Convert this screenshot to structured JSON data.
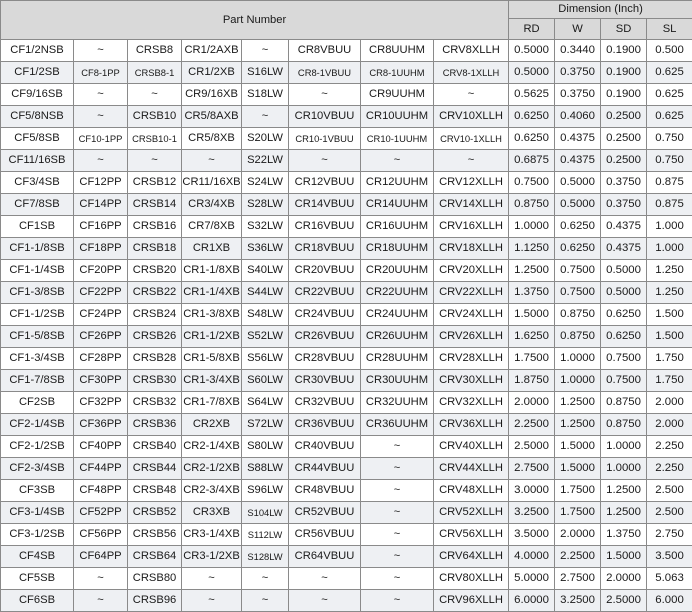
{
  "header": {
    "part_number": "Part Number",
    "dimension": "Dimension (Inch)",
    "sub_columns": [
      "RD",
      "W",
      "SD",
      "SL"
    ]
  },
  "rows": [
    [
      "CF1/2NSB",
      "~",
      "CRSB8",
      "CR1/2AXB",
      "~",
      "CR8VBUU",
      "CR8UUHM",
      "CRV8XLLH",
      "0.5000",
      "0.3440",
      "0.1900",
      "0.500"
    ],
    [
      "CF1/2SB",
      "CF8-1PP",
      "CRSB8-1",
      "CR1/2XB",
      "S16LW",
      "CR8-1VBUU",
      "CR8-1UUHM",
      "CRV8-1XLLH",
      "0.5000",
      "0.3750",
      "0.1900",
      "0.625"
    ],
    [
      "CF9/16SB",
      "~",
      "~",
      "CR9/16XB",
      "S18LW",
      "~",
      "CR9UUHM",
      "~",
      "0.5625",
      "0.3750",
      "0.1900",
      "0.625"
    ],
    [
      "CF5/8NSB",
      "~",
      "CRSB10",
      "CR5/8AXB",
      "~",
      "CR10VBUU",
      "CR10UUHM",
      "CRV10XLLH",
      "0.6250",
      "0.4060",
      "0.2500",
      "0.625"
    ],
    [
      "CF5/8SB",
      "CF10-1PP",
      "CRSB10-1",
      "CR5/8XB",
      "S20LW",
      "CR10-1VBUU",
      "CR10-1UUHM",
      "CRV10-1XLLH",
      "0.6250",
      "0.4375",
      "0.2500",
      "0.750"
    ],
    [
      "CF11/16SB",
      "~",
      "~",
      "~",
      "S22LW",
      "~",
      "~",
      "~",
      "0.6875",
      "0.4375",
      "0.2500",
      "0.750"
    ],
    [
      "CF3/4SB",
      "CF12PP",
      "CRSB12",
      "CR11/16XB",
      "S24LW",
      "CR12VBUU",
      "CR12UUHM",
      "CRV12XLLH",
      "0.7500",
      "0.5000",
      "0.3750",
      "0.875"
    ],
    [
      "CF7/8SB",
      "CF14PP",
      "CRSB14",
      "CR3/4XB",
      "S28LW",
      "CR14VBUU",
      "CR14UUHM",
      "CRV14XLLH",
      "0.8750",
      "0.5000",
      "0.3750",
      "0.875"
    ],
    [
      "CF1SB",
      "CF16PP",
      "CRSB16",
      "CR7/8XB",
      "S32LW",
      "CR16VBUU",
      "CR16UUHM",
      "CRV16XLLH",
      "1.0000",
      "0.6250",
      "0.4375",
      "1.000"
    ],
    [
      "CF1-1/8SB",
      "CF18PP",
      "CRSB18",
      "CR1XB",
      "S36LW",
      "CR18VBUU",
      "CR18UUHM",
      "CRV18XLLH",
      "1.1250",
      "0.6250",
      "0.4375",
      "1.000"
    ],
    [
      "CF1-1/4SB",
      "CF20PP",
      "CRSB20",
      "CR1-1/8XB",
      "S40LW",
      "CR20VBUU",
      "CR20UUHM",
      "CRV20XLLH",
      "1.2500",
      "0.7500",
      "0.5000",
      "1.250"
    ],
    [
      "CF1-3/8SB",
      "CF22PP",
      "CRSB22",
      "CR1-1/4XB",
      "S44LW",
      "CR22VBUU",
      "CR22UUHM",
      "CRV22XLLH",
      "1.3750",
      "0.7500",
      "0.5000",
      "1.250"
    ],
    [
      "CF1-1/2SB",
      "CF24PP",
      "CRSB24",
      "CR1-3/8XB",
      "S48LW",
      "CR24VBUU",
      "CR24UUHM",
      "CRV24XLLH",
      "1.5000",
      "0.8750",
      "0.6250",
      "1.500"
    ],
    [
      "CF1-5/8SB",
      "CF26PP",
      "CRSB26",
      "CR1-1/2XB",
      "S52LW",
      "CR26VBUU",
      "CR26UUHM",
      "CRV26XLLH",
      "1.6250",
      "0.8750",
      "0.6250",
      "1.500"
    ],
    [
      "CF1-3/4SB",
      "CF28PP",
      "CRSB28",
      "CR1-5/8XB",
      "S56LW",
      "CR28VBUU",
      "CR28UUHM",
      "CRV28XLLH",
      "1.7500",
      "1.0000",
      "0.7500",
      "1.750"
    ],
    [
      "CF1-7/8SB",
      "CF30PP",
      "CRSB30",
      "CR1-3/4XB",
      "S60LW",
      "CR30VBUU",
      "CR30UUHM",
      "CRV30XLLH",
      "1.8750",
      "1.0000",
      "0.7500",
      "1.750"
    ],
    [
      "CF2SB",
      "CF32PP",
      "CRSB32",
      "CR1-7/8XB",
      "S64LW",
      "CR32VBUU",
      "CR32UUHM",
      "CRV32XLLH",
      "2.0000",
      "1.2500",
      "0.8750",
      "2.000"
    ],
    [
      "CF2-1/4SB",
      "CF36PP",
      "CRSB36",
      "CR2XB",
      "S72LW",
      "CR36VBUU",
      "CR36UUHM",
      "CRV36XLLH",
      "2.2500",
      "1.2500",
      "0.8750",
      "2.000"
    ],
    [
      "CF2-1/2SB",
      "CF40PP",
      "CRSB40",
      "CR2-1/4XB",
      "S80LW",
      "CR40VBUU",
      "~",
      "CRV40XLLH",
      "2.5000",
      "1.5000",
      "1.0000",
      "2.250"
    ],
    [
      "CF2-3/4SB",
      "CF44PP",
      "CRSB44",
      "CR2-1/2XB",
      "S88LW",
      "CR44VBUU",
      "~",
      "CRV44XLLH",
      "2.7500",
      "1.5000",
      "1.0000",
      "2.250"
    ],
    [
      "CF3SB",
      "CF48PP",
      "CRSB48",
      "CR2-3/4XB",
      "S96LW",
      "CR48VBUU",
      "~",
      "CRV48XLLH",
      "3.0000",
      "1.7500",
      "1.2500",
      "2.500"
    ],
    [
      "CF3-1/4SB",
      "CF52PP",
      "CRSB52",
      "CR3XB",
      "S104LW",
      "CR52VBUU",
      "~",
      "CRV52XLLH",
      "3.2500",
      "1.7500",
      "1.2500",
      "2.500"
    ],
    [
      "CF3-1/2SB",
      "CF56PP",
      "CRSB56",
      "CR3-1/4XB",
      "S112LW",
      "CR56VBUU",
      "~",
      "CRV56XLLH",
      "3.5000",
      "2.0000",
      "1.3750",
      "2.750"
    ],
    [
      "CF4SB",
      "CF64PP",
      "CRSB64",
      "CR3-1/2XB",
      "S128LW",
      "CR64VBUU",
      "~",
      "CRV64XLLH",
      "4.0000",
      "2.2500",
      "1.5000",
      "3.500"
    ],
    [
      "CF5SB",
      "~",
      "CRSB80",
      "~",
      "~",
      "~",
      "~",
      "CRV80XLLH",
      "5.0000",
      "2.7500",
      "2.0000",
      "5.063"
    ],
    [
      "CF6SB",
      "~",
      "CRSB96",
      "~",
      "~",
      "~",
      "~",
      "CRV96XLLH",
      "6.0000",
      "3.2500",
      "2.5000",
      "6.000"
    ]
  ]
}
